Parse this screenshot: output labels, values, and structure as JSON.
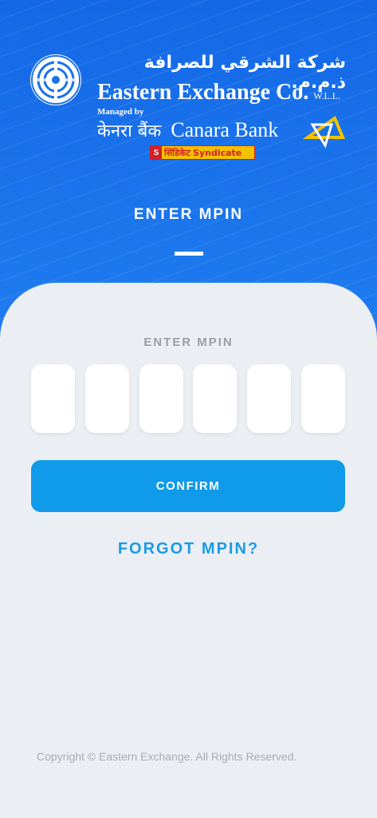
{
  "brand": {
    "arabic_name": "شركة الشرقي للصرافة ذ.م.م.",
    "company_name": "Eastern Exchange Co.",
    "company_suffix": "W.L.L.",
    "managed_by": "Managed by",
    "canara_hindi": "केनरा बैंक",
    "canara_english": "Canara Bank",
    "syndicate_hindi": "सिंडिकेट",
    "syndicate_english": "Syndicate"
  },
  "header": {
    "title": "ENTER MPIN"
  },
  "mpin": {
    "label": "ENTER MPIN",
    "digits": [
      "",
      "",
      "",
      "",
      "",
      ""
    ]
  },
  "actions": {
    "confirm_label": "CONFIRM",
    "forgot_label": "FORGOT MPIN?"
  },
  "footer": {
    "copyright": "Copyright © Eastern Exchange. All Rights Reserved."
  },
  "colors": {
    "header_blue": "#1a73e8",
    "confirm_blue": "#0f9bea",
    "link_blue": "#1a9be6",
    "background": "#ebeef3",
    "canara_yellow": "#f2c200",
    "syndicate_red": "#d31f26"
  }
}
